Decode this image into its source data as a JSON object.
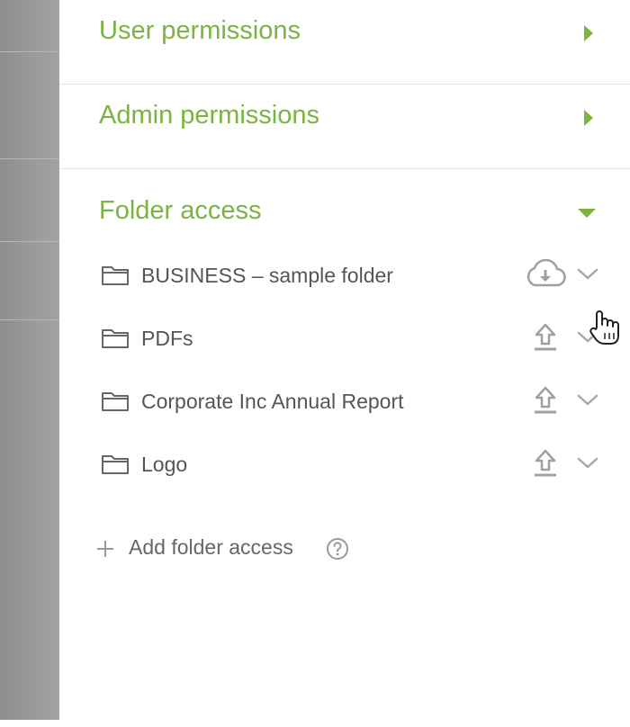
{
  "sections": {
    "user_permissions": {
      "title": "User permissions"
    },
    "admin_permissions": {
      "title": "Admin permissions"
    },
    "folder_access": {
      "title": "Folder access"
    }
  },
  "folders": [
    {
      "name": "BUSINESS – sample folder",
      "action_icon": "cloud-download-icon"
    },
    {
      "name": "PDFs",
      "action_icon": "upload-icon"
    },
    {
      "name": "Corporate Inc Annual Report",
      "action_icon": "upload-icon"
    },
    {
      "name": "Logo",
      "action_icon": "upload-icon"
    }
  ],
  "add_folder": {
    "label": "Add folder access"
  },
  "colors": {
    "accent_green": "#7cb342",
    "text_gray": "#555555",
    "icon_gray": "#9e9e9e",
    "backdrop": "#9a9a9a"
  }
}
